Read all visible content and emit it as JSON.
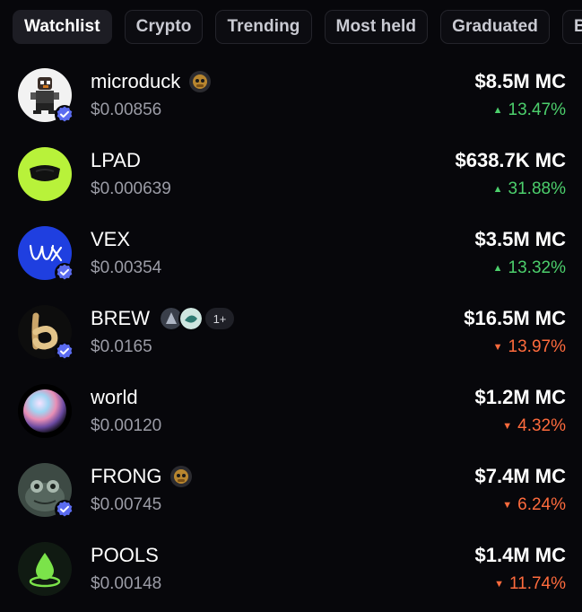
{
  "tabs": [
    {
      "label": "Watchlist",
      "active": true
    },
    {
      "label": "Crypto",
      "active": false
    },
    {
      "label": "Trending",
      "active": false
    },
    {
      "label": "Most held",
      "active": false
    },
    {
      "label": "Graduated",
      "active": false
    },
    {
      "label": "Bo",
      "active": false
    }
  ],
  "tokens": [
    {
      "name": "microduck",
      "price": "$0.00856",
      "market_cap": "$8.5M MC",
      "change": "13.47%",
      "direction": "up",
      "verified": true,
      "icon": "duck-robot-avatar"
    },
    {
      "name": "LPAD",
      "price": "$0.000639",
      "market_cap": "$638.7K MC",
      "change": "31.88%",
      "direction": "up",
      "verified": false,
      "icon": "lime-visor-avatar"
    },
    {
      "name": "VEX",
      "price": "$0.00354",
      "market_cap": "$3.5M MC",
      "change": "13.32%",
      "direction": "up",
      "verified": true,
      "icon": "blue-script-logo"
    },
    {
      "name": "BREW",
      "price": "$0.0165",
      "market_cap": "$16.5M MC",
      "change": "13.97%",
      "direction": "down",
      "verified": true,
      "icon": "gold-b-logo",
      "holders_more": "1+"
    },
    {
      "name": "world",
      "price": "$0.00120",
      "market_cap": "$1.2M MC",
      "change": "4.32%",
      "direction": "down",
      "verified": false,
      "icon": "iridescent-orb"
    },
    {
      "name": "FRONG",
      "price": "$0.00745",
      "market_cap": "$7.4M MC",
      "change": "6.24%",
      "direction": "down",
      "verified": true,
      "icon": "frog-avatar"
    },
    {
      "name": "POOLS",
      "price": "$0.00148",
      "market_cap": "$1.4M MC",
      "change": "11.74%",
      "direction": "down",
      "verified": false,
      "icon": "green-drop-logo"
    }
  ],
  "colors": {
    "up": "#4ccf6c",
    "down": "#ff6b3d",
    "verified": "#5b6cf0"
  }
}
